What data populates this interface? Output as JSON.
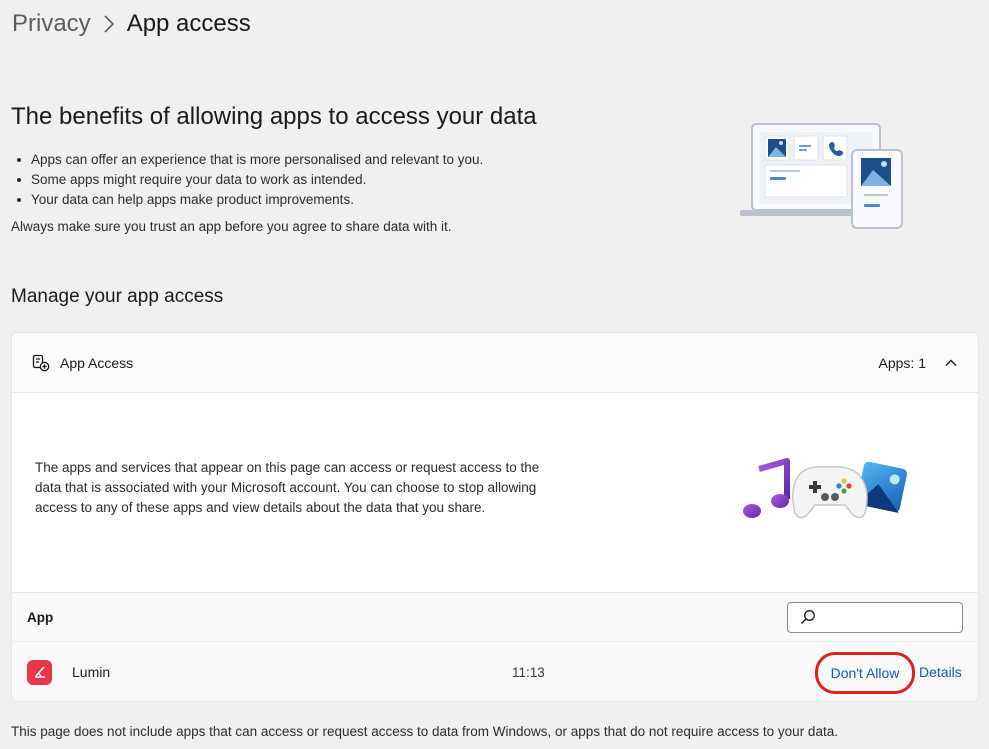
{
  "breadcrumb": {
    "parent": "Privacy",
    "current": "App access"
  },
  "benefits": {
    "title": "The benefits of allowing apps to access your data",
    "bullets": [
      "Apps can offer an experience that is more personalised and relevant to you.",
      "Some apps might require your data to work as intended.",
      "Your data can help apps make product improvements."
    ],
    "trust_note": "Always make sure you trust an app before you agree to share data with it."
  },
  "manage": {
    "title": "Manage your app access",
    "card": {
      "header_label": "App Access",
      "apps_count": "Apps: 1",
      "description": "The apps and services that appear on this page can access or request access to the data that is associated with your Microsoft account. You can choose to stop allowing access to any of these apps and view details about the data that you share.",
      "table": {
        "column_app": "App",
        "search_placeholder": "",
        "rows": [
          {
            "name": "Lumin",
            "time": "11:13",
            "dont_allow": "Don't Allow",
            "details": "Details"
          }
        ]
      }
    }
  },
  "footer_note": "This page does not include apps that can access or request access to data from Windows, or apps that do not require access to your data.",
  "colors": {
    "accent_link": "#0a5bb5",
    "highlight_ring": "#e0201b",
    "lumin_brand": "#e8364f",
    "background": "#f0f0f0"
  },
  "icons": {
    "breadcrumb_separator": "chevron-right-icon",
    "card_header": "app-access-icon",
    "collapse": "chevron-up-icon",
    "search": "search-icon",
    "app_logo": "lumin-logo"
  }
}
